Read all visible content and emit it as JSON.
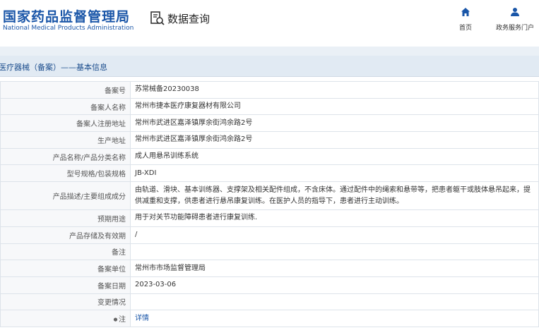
{
  "header": {
    "logo_cn": "国家药品监督管理局",
    "logo_en": "National Medical Products Administration",
    "query_label": "数据查询",
    "nav": [
      {
        "label": "首页",
        "icon": "home-icon"
      },
      {
        "label": "政务服务门户",
        "icon": "user-icon"
      }
    ]
  },
  "breadcrumb": "医疗器械（备案）——基本信息",
  "rows": [
    {
      "key": "备案号",
      "value": "苏常械备20230038"
    },
    {
      "key": "备案人名称",
      "value": "常州市捷本医疗康复器材有限公司"
    },
    {
      "key": "备案人注册地址",
      "value": "常州市武进区嘉泽镇厚余街鸿余路2号"
    },
    {
      "key": "生产地址",
      "value": "常州市武进区嘉泽镇厚余街鸿余路2号"
    },
    {
      "key": "产品名称/产品分类名称",
      "value": "成人用悬吊训练系统"
    },
    {
      "key": "型号规格/包装规格",
      "value": "JB-XDI"
    },
    {
      "key": "产品描述/主要组成成分",
      "value": "由轨道、滑块、基本训练器、支撑架及相关配件组成，不含床体。通过配件中的绳索和悬带等，把患者躯干或肢体悬吊起来，提供减重和支撑，供患者进行悬吊康复训练。在医护人员的指导下，患者进行主动训练。"
    },
    {
      "key": "预期用途",
      "value": "用于对关节功能障碍患者进行康复训练."
    },
    {
      "key": "产品存储及有效期",
      "value": "/"
    },
    {
      "key": "备注",
      "value": ""
    },
    {
      "key": "备案单位",
      "value": "常州市市场监督管理局"
    },
    {
      "key": "备案日期",
      "value": "2023-03-06"
    },
    {
      "key": "变更情况",
      "value": ""
    },
    {
      "key": "注",
      "value": "详情"
    }
  ],
  "colors": {
    "brand": "#1a56a8",
    "breadcrumb_bg": "#e1eaf3"
  }
}
